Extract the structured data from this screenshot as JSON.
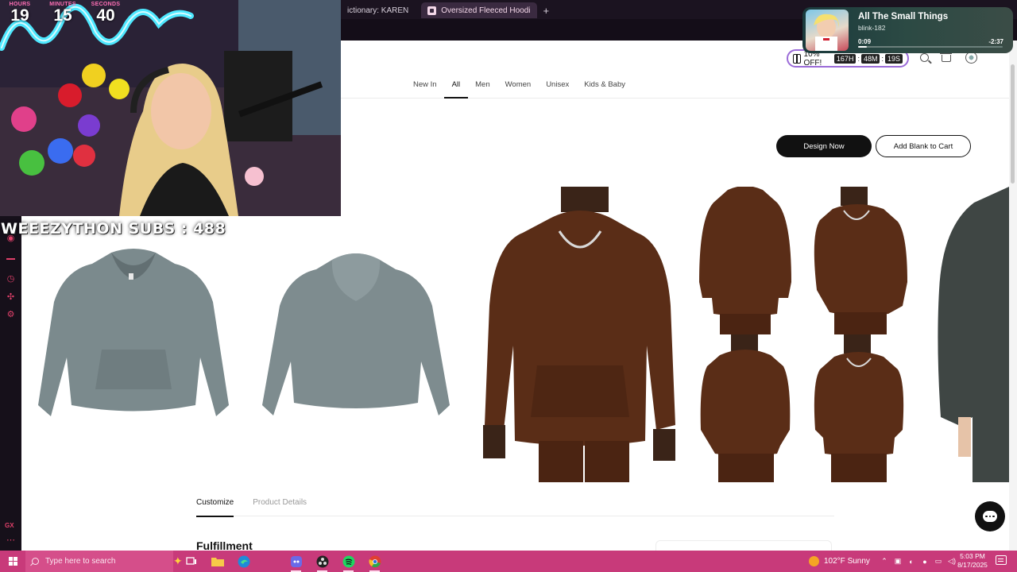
{
  "browser": {
    "tabs": [
      {
        "label": "ictionary: KAREN",
        "active": false
      },
      {
        "label": "Oversized Fleeced Hoodi",
        "active": true
      }
    ],
    "new_tab_symbol": "+"
  },
  "stream_overlay": {
    "timer": [
      {
        "label": "HOURS",
        "value": "19"
      },
      {
        "label": "MINUTES",
        "value": "15"
      },
      {
        "label": "SECONDS",
        "value": "40"
      }
    ],
    "subs_banner": "WEEEZYTHON SUBS : 488"
  },
  "now_playing": {
    "title": "All The Small Things",
    "artist": "blink-182",
    "elapsed": "0:09",
    "remaining": "-2:37",
    "progress_fraction": 0.06
  },
  "site": {
    "promo": {
      "text": "10% OFF!",
      "countdown": [
        {
          "value": "167H"
        },
        {
          "value": "48M"
        },
        {
          "value": "19S"
        }
      ],
      "separator": ":"
    },
    "nav": [
      {
        "label": "New In",
        "active": false
      },
      {
        "label": "All",
        "active": true
      },
      {
        "label": "Men",
        "active": false
      },
      {
        "label": "Women",
        "active": false
      },
      {
        "label": "Unisex",
        "active": false
      },
      {
        "label": "Kids & Baby",
        "active": false
      }
    ],
    "actions": {
      "design_now": "Design Now",
      "add_blank_to_cart": "Add Blank to Cart"
    },
    "product_tabs": [
      {
        "label": "Customize",
        "active": true
      },
      {
        "label": "Product Details",
        "active": false
      }
    ],
    "section_heading": "Fulfillment",
    "colors": {
      "hoodie_gray": "#7b8a8d",
      "hoodie_brown": "#5a2d17",
      "accent": "#111111"
    }
  },
  "taskbar": {
    "search_placeholder": "Type here to search",
    "weather": "102°F  Sunny",
    "time": "5:03 PM",
    "date": "8/17/2025",
    "color": "#c83a7a",
    "apps": [
      "task-view-icon",
      "file-explorer-icon",
      "edge-icon",
      "discord-icon",
      "obs-icon",
      "spotify-icon",
      "chrome-icon"
    ]
  }
}
